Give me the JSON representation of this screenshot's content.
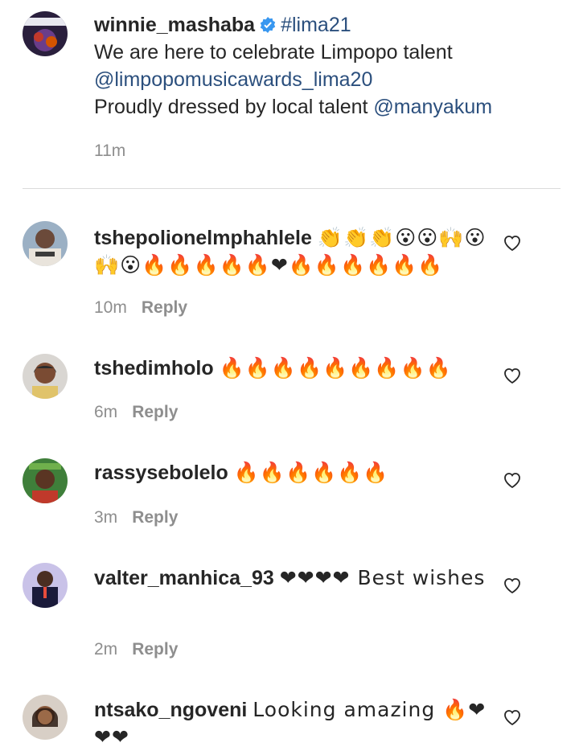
{
  "caption": {
    "username": "winnie_mashaba",
    "hashtag": "#lima21",
    "line1": "We are here to celebrate Limpopo talent",
    "mention1": "@limpopomusicawards_lima20",
    "line3": "Proudly dressed by local talent ",
    "mention2": "@manyakum",
    "time": "11m"
  },
  "comments": [
    {
      "username": "tshepolionelmphahlele",
      "text": "👏👏👏😮😮🙌😮🙌😮🔥🔥🔥🔥🔥❤🔥🔥🔥🔥🔥🔥",
      "time": "10m",
      "reply": "Reply"
    },
    {
      "username": "tshedimholo",
      "text": "🔥🔥🔥🔥🔥🔥🔥🔥🔥",
      "time": "6m",
      "reply": "Reply"
    },
    {
      "username": "rassysebolelo",
      "text": "🔥🔥🔥🔥🔥🔥",
      "time": "3m",
      "reply": "Reply"
    },
    {
      "username": "valter_manhica_93",
      "text": "❤❤❤❤ Best wishes",
      "time": "2m",
      "reply": "Reply"
    },
    {
      "username": "ntsako_ngoveni",
      "text": "Looking amazing 🔥❤❤❤",
      "time": "",
      "reply": ""
    }
  ],
  "icons": {
    "verified": "verified-badge-icon",
    "like": "heart-outline-icon"
  },
  "colors": {
    "link": "#2b4f7d",
    "verified": "#3897f0",
    "muted": "#8e8e8e"
  }
}
